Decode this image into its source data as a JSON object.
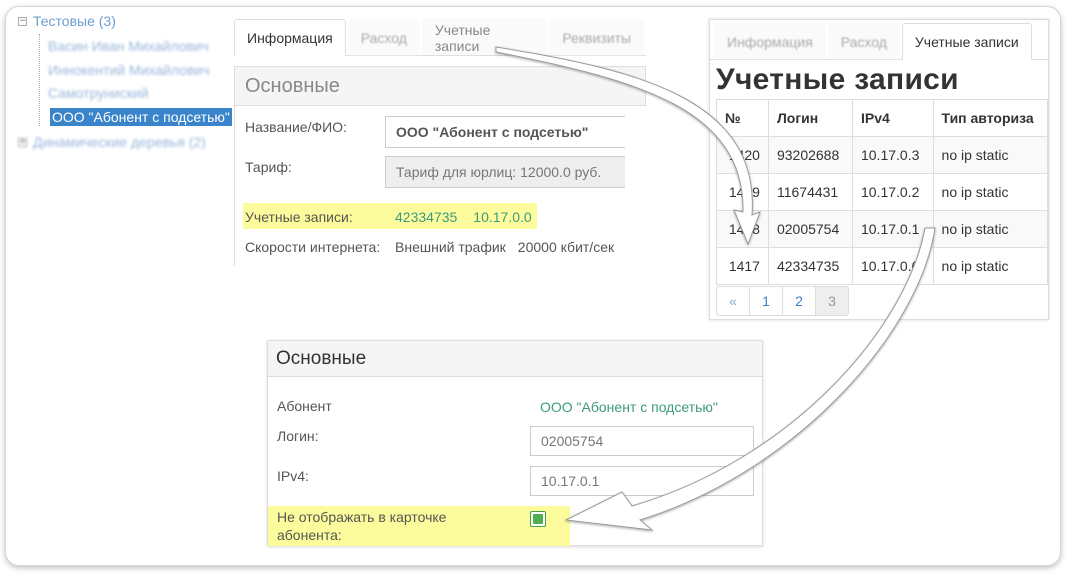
{
  "tree": {
    "root_label": "Тестовые (3)",
    "toggle_root": "−",
    "children": [
      "Васин Иван Михайлович",
      "Иннокентий Михайлович",
      "Самотруниский"
    ],
    "selected_label": "ООО \"Абонент с подсетью\"",
    "root2_label": "Динамические деревья (2)",
    "toggle_root2": "+"
  },
  "panelA": {
    "tabs": [
      "Информация",
      "Расход",
      "Учетные записи",
      "Реквизиты"
    ],
    "section_title": "Основные",
    "fields": {
      "name_label": "Название/ФИО:",
      "name_value": "ООО \"Абонент с подсетью\"",
      "tariff_label": "Тариф:",
      "tariff_value": "Тариф для юрлиц: 12000.0 руб.",
      "accounts_label": "Учетные записи:",
      "account_login": "42334735",
      "account_ip": "10.17.0.0",
      "speed_label": "Скорости интернета:",
      "speed_type": "Внешний трафик",
      "speed_value": "20000 кбит/сек"
    }
  },
  "panelB": {
    "tabs": [
      "Информация",
      "Расход",
      "Учетные записи"
    ],
    "title": "Учетные записи",
    "columns": [
      "№",
      "Логин",
      "IPv4",
      "Тип авториза"
    ],
    "rows": [
      [
        "1420",
        "93202688",
        "10.17.0.3",
        "no ip static"
      ],
      [
        "1419",
        "11674431",
        "10.17.0.2",
        "no ip static"
      ],
      [
        "1418",
        "02005754",
        "10.17.0.1",
        "no ip static"
      ],
      [
        "1417",
        "42334735",
        "10.17.0.0",
        "no ip static"
      ]
    ],
    "pager": {
      "first_icon": "«",
      "pages": [
        "1",
        "2"
      ],
      "current": "3"
    }
  },
  "panelC": {
    "section_title": "Основные",
    "subscriber_label": "Абонент",
    "subscriber_value": "ООО \"Абонент с подсетью\"",
    "login_label": "Логин:",
    "login_value": "02005754",
    "ip_label": "IPv4:",
    "ip_value": "10.17.0.1",
    "hide_label_line1": "Не отображать в карточке",
    "hide_label_line2": "абонента:",
    "hide_checked": true
  },
  "colors": {
    "link": "#3d9a7c",
    "accent": "#3a84c9",
    "highlight": "#fcfc9c",
    "checkbox": "#50b050"
  }
}
